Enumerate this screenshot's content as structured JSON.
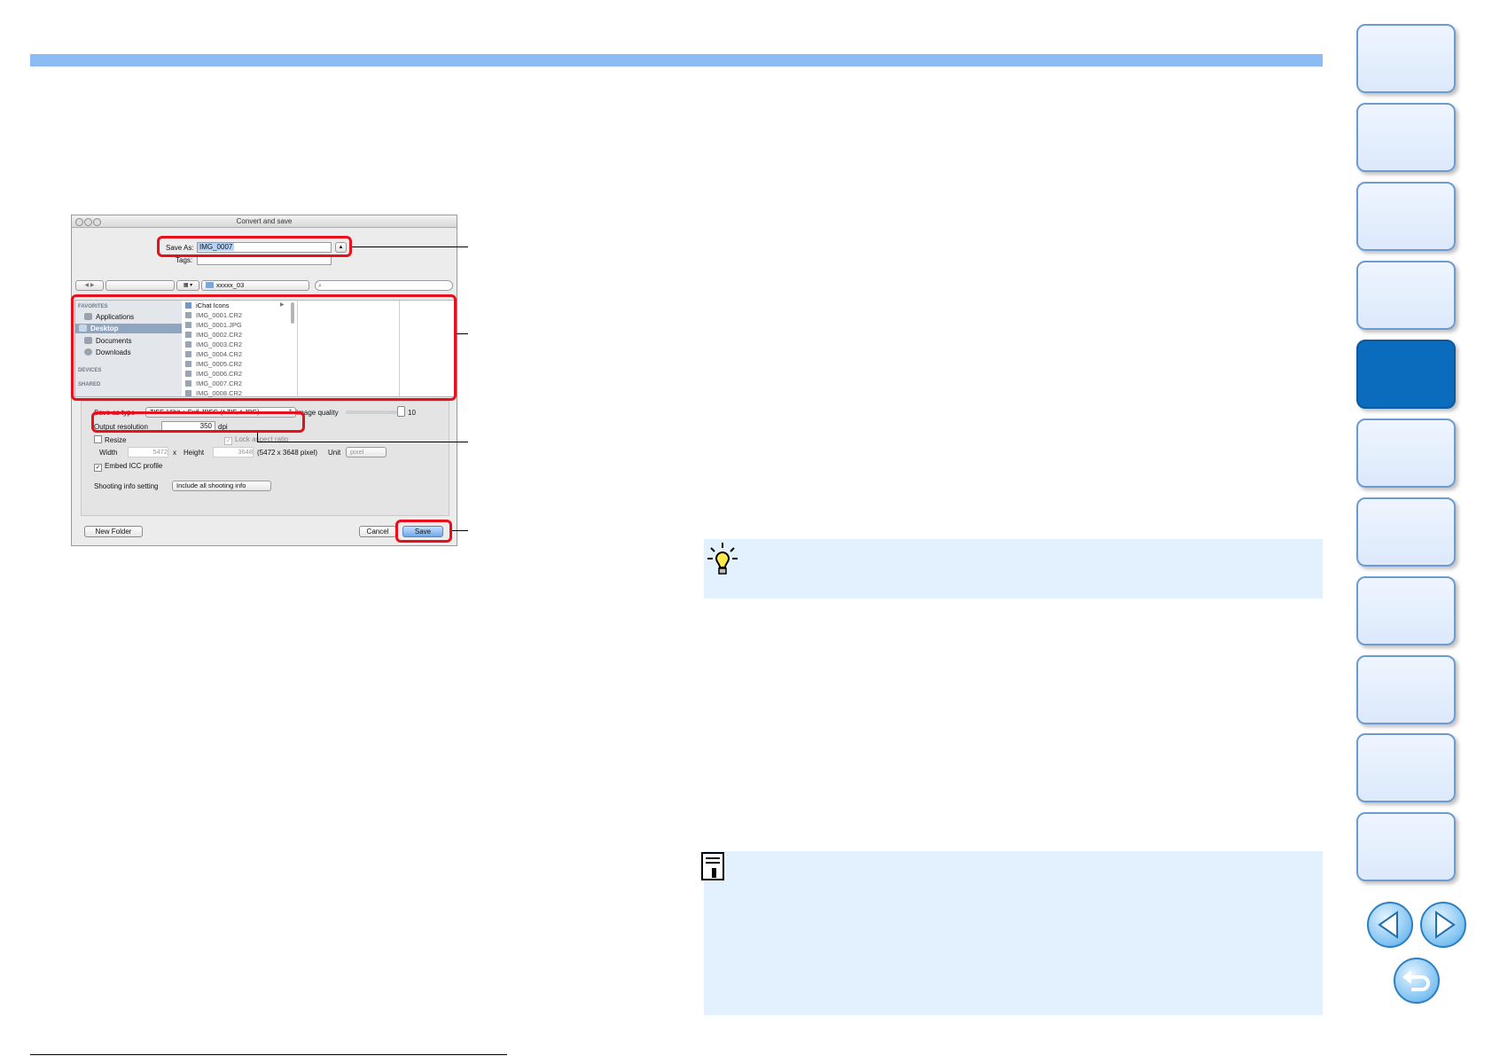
{
  "dialog": {
    "title": "Convert and save",
    "save_as_label": "Save As:",
    "save_as_value": "IMG_0007",
    "tags_label": "Tags:",
    "folder_popup": "xxxxx_03",
    "sidebar": {
      "favorites_heading": "FAVORITES",
      "items": [
        "Applications",
        "Desktop",
        "Documents",
        "Downloads"
      ],
      "selected": "Desktop",
      "devices_heading": "DEVICES",
      "shared_heading": "SHARED"
    },
    "files": [
      "iChat Icons",
      "IMG_0001.CR2",
      "IMG_0001.JPG",
      "IMG_0002.CR2",
      "IMG_0003.CR2",
      "IMG_0004.CR2",
      "IMG_0005.CR2",
      "IMG_0006.CR2",
      "IMG_0007.CR2",
      "IMG_0008.CR2"
    ],
    "options": {
      "save_as_type_label": "Save as type",
      "save_as_type_value": "TIFF 16bit + Exif-JPEG (*.TIF, *.JPG)",
      "image_quality_label": "Image quality",
      "image_quality_value": "10",
      "output_resolution_label": "Output resolution",
      "output_resolution_value": "350",
      "dpi_label": "dpi",
      "resize_label": "Resize",
      "lock_aspect_label": "Lock aspect ratio",
      "width_label": "Width",
      "width_value": "5472",
      "x_label": "x",
      "height_label": "Height",
      "height_value": "3648",
      "pixel_info": "(5472 x 3648 pixel)",
      "unit_label": "Unit",
      "unit_value": "pixel",
      "embed_icc_label": "Embed ICC profile",
      "shooting_info_label": "Shooting info setting",
      "shooting_info_value": "Include all shooting info"
    },
    "buttons": {
      "new_folder": "New Folder",
      "cancel": "Cancel",
      "save": "Save"
    }
  },
  "colors": {
    "header_bar": "#8dbcf5",
    "highlight": "#e8101a",
    "tab_active": "#0b6cbd",
    "box_background": "#e3f0fd"
  },
  "icons": {
    "tip": "lightbulb-icon",
    "note": "memo-icon",
    "prev": "triangle-left-icon",
    "next": "triangle-right-icon",
    "return": "return-arrow-icon"
  }
}
